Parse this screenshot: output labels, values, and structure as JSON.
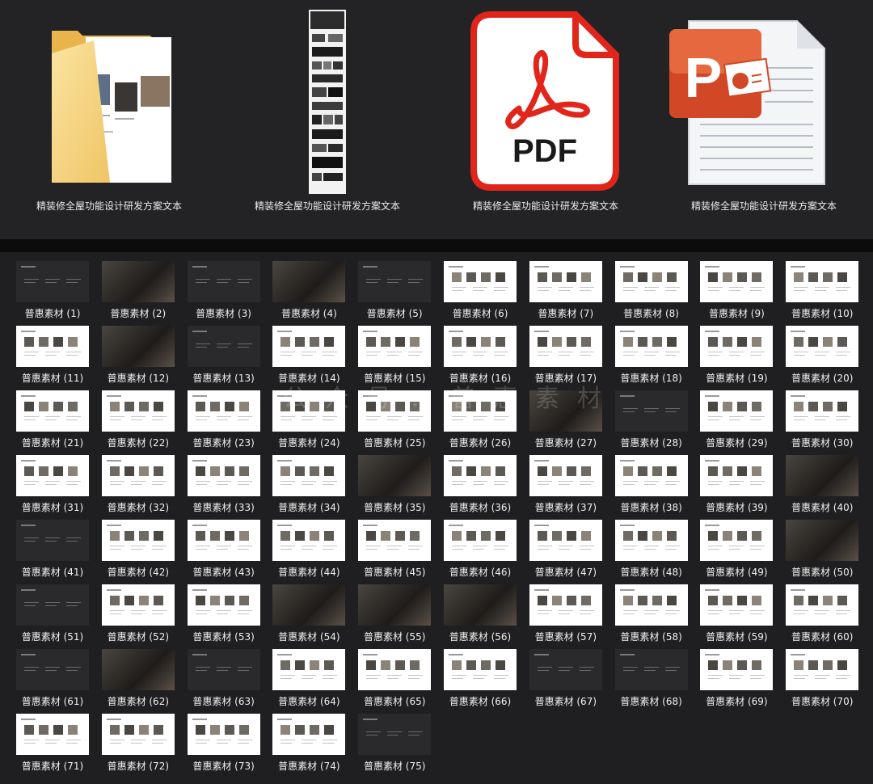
{
  "files": [
    {
      "name": "精装修全屋功能设计研发方案文本",
      "type": "folder",
      "icon": "folder-icon"
    },
    {
      "name": "精装修全屋功能设计研发方案文本",
      "type": "long-image",
      "icon": "long-image-icon"
    },
    {
      "name": "精装修全屋功能设计研发方案文本",
      "type": "pdf",
      "icon": "pdf-icon",
      "badge": "PDF",
      "accent": "#e1251b"
    },
    {
      "name": "精装修全屋功能设计研发方案文本",
      "type": "ppt",
      "icon": "powerpoint-icon",
      "badge": "P",
      "accent": "#d24726"
    }
  ],
  "thumbnails": [
    "普惠素材 (1)",
    "普惠素材 (2)",
    "普惠素材 (3)",
    "普惠素材 (4)",
    "普惠素材 (5)",
    "普惠素材 (6)",
    "普惠素材 (7)",
    "普惠素材 (8)",
    "普惠素材 (9)",
    "普惠素材 (10)",
    "普惠素材 (11)",
    "普惠素材 (12)",
    "普惠素材 (13)",
    "普惠素材 (14)",
    "普惠素材 (15)",
    "普惠素材 (16)",
    "普惠素材 (17)",
    "普惠素材 (18)",
    "普惠素材 (19)",
    "普惠素材 (20)",
    "普惠素材 (21)",
    "普惠素材 (22)",
    "普惠素材 (23)",
    "普惠素材 (24)",
    "普惠素材 (25)",
    "普惠素材 (26)",
    "普惠素材 (27)",
    "普惠素材 (28)",
    "普惠素材 (29)",
    "普惠素材 (30)",
    "普惠素材 (31)",
    "普惠素材 (32)",
    "普惠素材 (33)",
    "普惠素材 (34)",
    "普惠素材 (35)",
    "普惠素材 (36)",
    "普惠素材 (37)",
    "普惠素材 (38)",
    "普惠素材 (39)",
    "普惠素材 (40)",
    "普惠素材 (41)",
    "普惠素材 (42)",
    "普惠素材 (43)",
    "普惠素材 (44)",
    "普惠素材 (45)",
    "普惠素材 (46)",
    "普惠素材 (47)",
    "普惠素材 (48)",
    "普惠素材 (49)",
    "普惠素材 (50)",
    "普惠素材 (51)",
    "普惠素材 (52)",
    "普惠素材 (53)",
    "普惠素材 (54)",
    "普惠素材 (55)",
    "普惠素材 (56)",
    "普惠素材 (57)",
    "普惠素材 (58)",
    "普惠素材 (59)",
    "普惠素材 (60)",
    "普惠素材 (61)",
    "普惠素材 (62)",
    "普惠素材 (63)",
    "普惠素材 (64)",
    "普惠素材 (65)",
    "普惠素材 (66)",
    "普惠素材 (67)",
    "普惠素材 (68)",
    "普惠素材 (69)",
    "普惠素材 (70)",
    "普惠素材 (71)",
    "普惠素材 (72)",
    "普惠素材 (73)",
    "普惠素材 (74)",
    "普惠素材 (75)"
  ],
  "watermark": "公众号：普惠素材",
  "colors": {
    "background": "#1f1f21",
    "separator": "#0c0c0d",
    "label": "#f0f0f0"
  }
}
